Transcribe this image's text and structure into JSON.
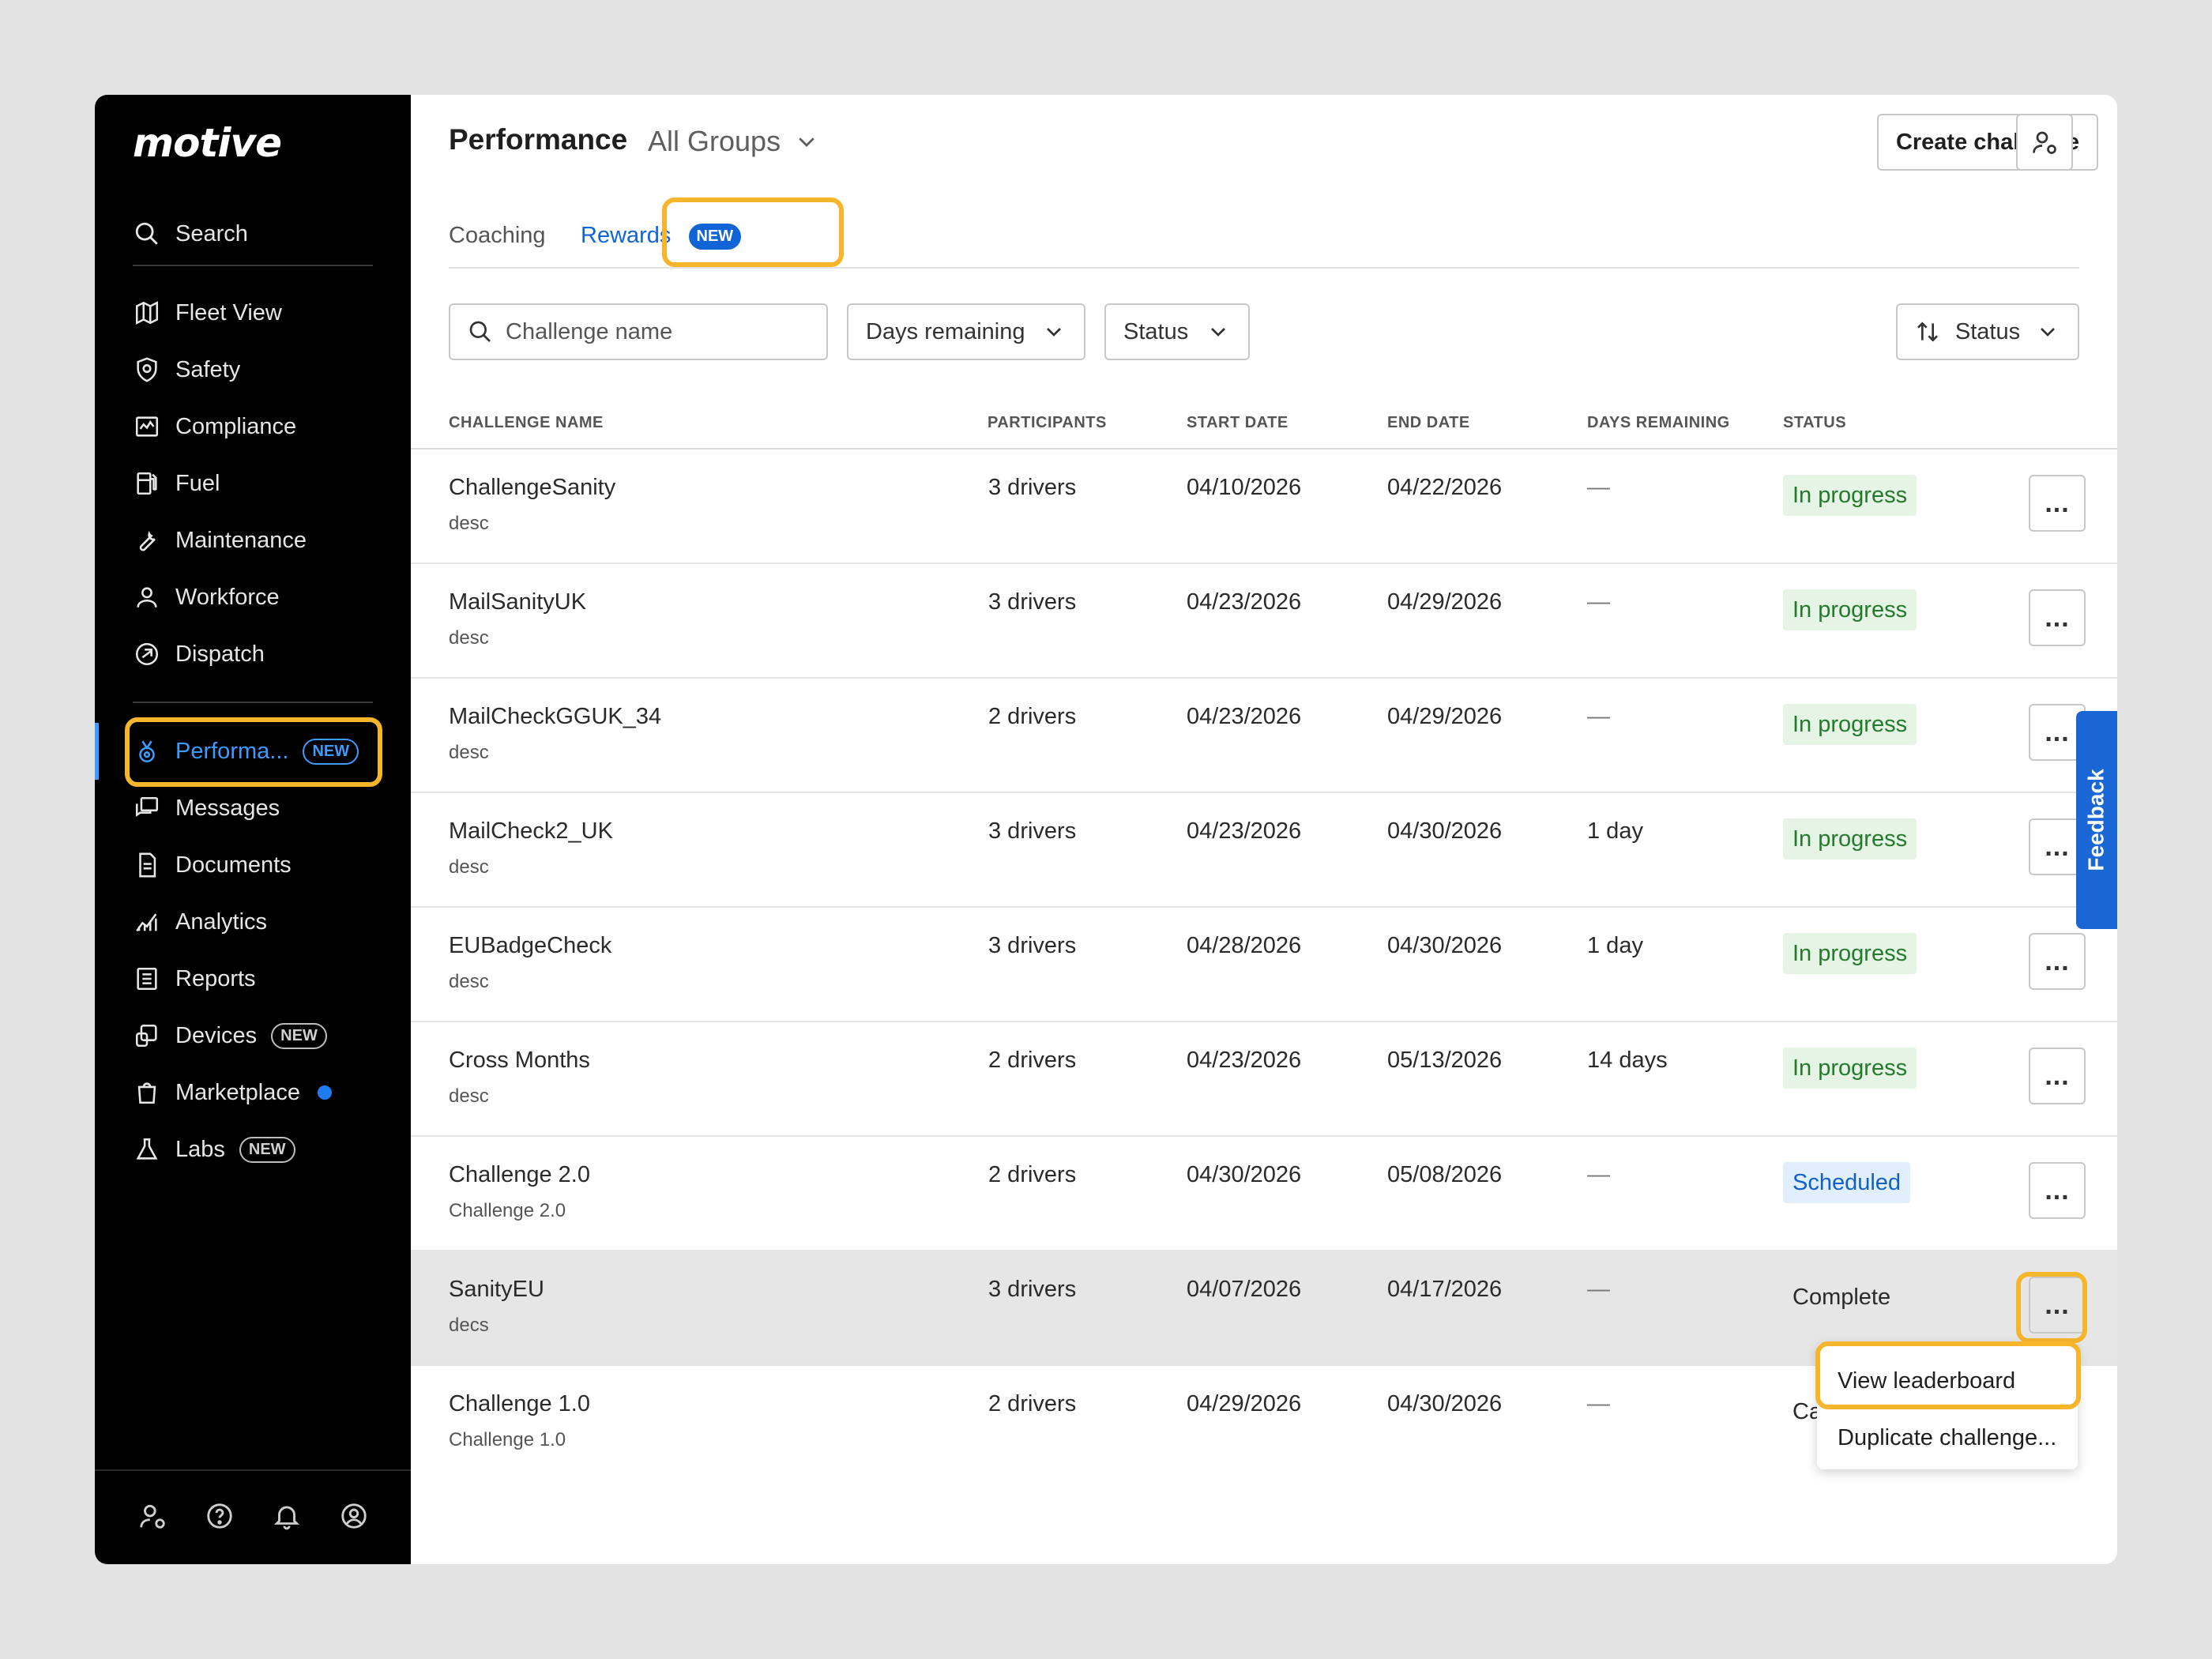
{
  "app": {
    "logo": "motive"
  },
  "sidebar": {
    "search_label": "Search",
    "items": [
      {
        "label": "Fleet View",
        "icon": "map-icon"
      },
      {
        "label": "Safety",
        "icon": "shield-icon"
      },
      {
        "label": "Compliance",
        "icon": "compliance-icon"
      },
      {
        "label": "Fuel",
        "icon": "fuel-icon"
      },
      {
        "label": "Maintenance",
        "icon": "wrench-icon"
      },
      {
        "label": "Workforce",
        "icon": "person-icon"
      },
      {
        "label": "Dispatch",
        "icon": "dispatch-icon"
      },
      {
        "label": "Performa...",
        "icon": "medal-icon",
        "badge": "NEW",
        "active": true
      },
      {
        "label": "Messages",
        "icon": "messages-icon"
      },
      {
        "label": "Documents",
        "icon": "document-icon"
      },
      {
        "label": "Analytics",
        "icon": "analytics-icon"
      },
      {
        "label": "Reports",
        "icon": "reports-icon"
      },
      {
        "label": "Devices",
        "icon": "devices-icon",
        "badge": "NEW"
      },
      {
        "label": "Marketplace",
        "icon": "bag-icon",
        "dot": true
      },
      {
        "label": "Labs",
        "icon": "flask-icon",
        "badge": "NEW"
      }
    ]
  },
  "header": {
    "title": "Performance",
    "group": "All Groups",
    "create_label": "Create challenge"
  },
  "tabs": [
    {
      "label": "Coaching"
    },
    {
      "label": "Rewards",
      "badge": "NEW",
      "active": true
    }
  ],
  "filters": {
    "search_placeholder": "Challenge name",
    "days_remaining": "Days remaining",
    "status": "Status",
    "sort": "Status"
  },
  "table": {
    "columns": [
      "CHALLENGE NAME",
      "PARTICIPANTS",
      "START DATE",
      "END DATE",
      "DAYS REMAINING",
      "STATUS"
    ],
    "rows": [
      {
        "name": "ChallengeSanity",
        "desc": "desc",
        "participants": "3 drivers",
        "start": "04/10/2026",
        "end": "04/22/2026",
        "days": "—",
        "status": "In progress"
      },
      {
        "name": "MailSanityUK",
        "desc": "desc",
        "participants": "3 drivers",
        "start": "04/23/2026",
        "end": "04/29/2026",
        "days": "—",
        "status": "In progress"
      },
      {
        "name": "MailCheckGGUK_34",
        "desc": "desc",
        "participants": "2 drivers",
        "start": "04/23/2026",
        "end": "04/29/2026",
        "days": "—",
        "status": "In progress"
      },
      {
        "name": "MailCheck2_UK",
        "desc": "desc",
        "participants": "3 drivers",
        "start": "04/23/2026",
        "end": "04/30/2026",
        "days": "1 day",
        "status": "In progress"
      },
      {
        "name": "EUBadgeCheck",
        "desc": "desc",
        "participants": "3 drivers",
        "start": "04/28/2026",
        "end": "04/30/2026",
        "days": "1 day",
        "status": "In progress"
      },
      {
        "name": "Cross Months",
        "desc": "desc",
        "participants": "2 drivers",
        "start": "04/23/2026",
        "end": "05/13/2026",
        "days": "14 days",
        "status": "In progress"
      },
      {
        "name": "Challenge 2.0",
        "desc": "Challenge 2.0",
        "participants": "2 drivers",
        "start": "04/30/2026",
        "end": "05/08/2026",
        "days": "—",
        "status": "Scheduled"
      },
      {
        "name": "SanityEU",
        "desc": "decs",
        "participants": "3 drivers",
        "start": "04/07/2026",
        "end": "04/17/2026",
        "days": "—",
        "status": "Complete"
      },
      {
        "name": "Challenge 1.0",
        "desc": "Challenge 1.0",
        "participants": "2 drivers",
        "start": "04/29/2026",
        "end": "04/30/2026",
        "days": "—",
        "status": "Ca"
      }
    ],
    "more_label": "..."
  },
  "row_menu": {
    "items": [
      "View leaderboard",
      "Duplicate challenge..."
    ]
  },
  "feedback_label": "Feedback",
  "colors": {
    "accent": "#1064d6",
    "highlight": "#f7b52c",
    "in_progress_bg": "#e5f4e5",
    "in_progress_text": "#247a2c",
    "scheduled_bg": "#e1effd",
    "scheduled_text": "#1160c9"
  }
}
